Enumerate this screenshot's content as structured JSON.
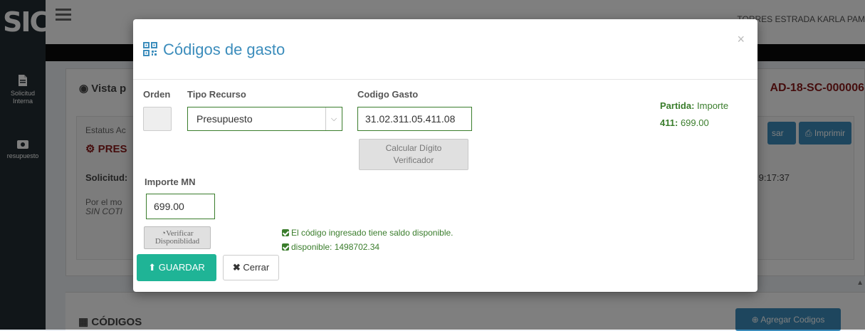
{
  "app": {
    "logo": "SIC",
    "user_name": "TORRES ESTRADA KARLA PAM",
    "sidebar": [
      {
        "label_line1": "Solicitud",
        "label_line2": "Interna",
        "icon": "document-icon"
      },
      {
        "label_line1": "resupuesto",
        "label_line2": "",
        "icon": "money-icon"
      }
    ]
  },
  "background": {
    "vista_title": "Vista p",
    "folio": "AD-18-SC-000006",
    "estatus_label": "Estatus Ac",
    "estatus_value": "PRES",
    "solicitud_label": "Solicitud:",
    "time_text": "9:17:37",
    "por_el_mo": "Por el mo",
    "sin_coti": "SIN COTI",
    "btn_usar": "sar",
    "btn_imprimir": "Imprimir",
    "codigos_title": "CÓDIGOS",
    "btn_agregar": "Agregar Codigos"
  },
  "modal": {
    "title": "Códigos de gasto",
    "close_symbol": "×",
    "labels": {
      "orden": "Orden",
      "tipo_recurso": "Tipo Recurso",
      "codigo_gasto": "Codigo Gasto",
      "importe_mn": "Importe MN"
    },
    "tipo_recurso_value": "Presupuesto",
    "codigo_gasto_value": "31.02.311.05.411.08",
    "importe_value": "699.00",
    "btn_calcular_line1": "Calcular Dígito",
    "btn_calcular_line2": "Verificador",
    "btn_verificar_line1": "Verificar",
    "btn_verificar_line2": "Disponiblidad",
    "msg_saldo": "El código ingresado tiene saldo disponible.",
    "msg_disponible": "disponible: 1498702.34",
    "btn_guardar": "GUARDAR",
    "btn_cerrar": "Cerrar",
    "partida_label": "Partida:",
    "partida_importe_label": "Importe",
    "partida_code": "411:",
    "partida_amount": "699.00"
  },
  "colors": {
    "accent_blue": "#3c8dbc",
    "success_green": "#3a7d2c",
    "guardar_teal": "#1fb496",
    "folio_red": "#8b1a1a"
  }
}
